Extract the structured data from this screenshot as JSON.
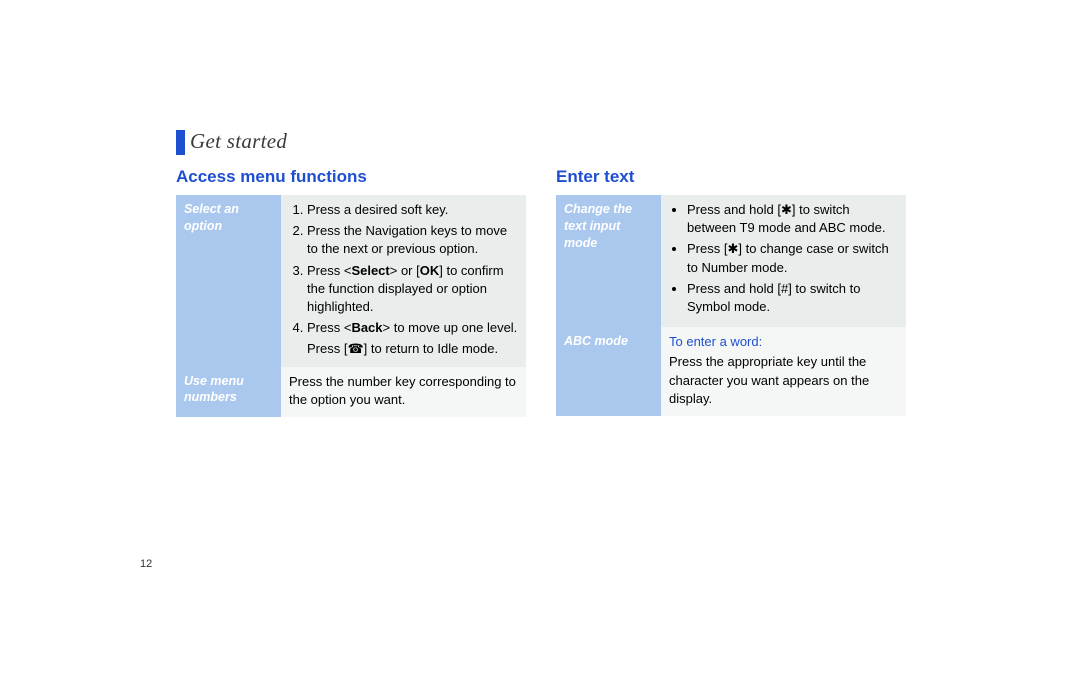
{
  "section_title": "Get started",
  "page_number": "12",
  "left": {
    "heading": "Access menu functions",
    "rows": [
      {
        "side": "Select an option",
        "step1": "Press a desired soft key.",
        "step2": "Press the Navigation keys to move to the next or previous option.",
        "step3_pre": "Press <",
        "step3_b1": "Select",
        "step3_mid": "> or [",
        "step3_b2": "OK",
        "step3_post": "] to confirm the function displayed or option highlighted.",
        "step4_pre": "Press <",
        "step4_b1": "Back",
        "step4_post": "> to move up one level.",
        "after_pre": "Press [",
        "after_icon": "☎",
        "after_post": "] to return to Idle mode."
      },
      {
        "side": "Use menu numbers",
        "body": "Press the number key corresponding to the option you want."
      }
    ]
  },
  "right": {
    "heading": "Enter text",
    "rows": [
      {
        "side": "Change the text input mode",
        "b1_pre": "Press and hold [",
        "b1_icon": "✱",
        "b1_post": "] to switch between T9 mode and ABC mode.",
        "b2_pre": "Press [",
        "b2_icon": "✱",
        "b2_post": "] to change case or switch to Number mode.",
        "b3_pre": "Press and hold [",
        "b3_icon": "#",
        "b3_post": "] to switch to Symbol mode."
      },
      {
        "side": "ABC mode",
        "sub": "To enter a word:",
        "body": "Press the appropriate key until the character you want appears on the display."
      }
    ]
  }
}
